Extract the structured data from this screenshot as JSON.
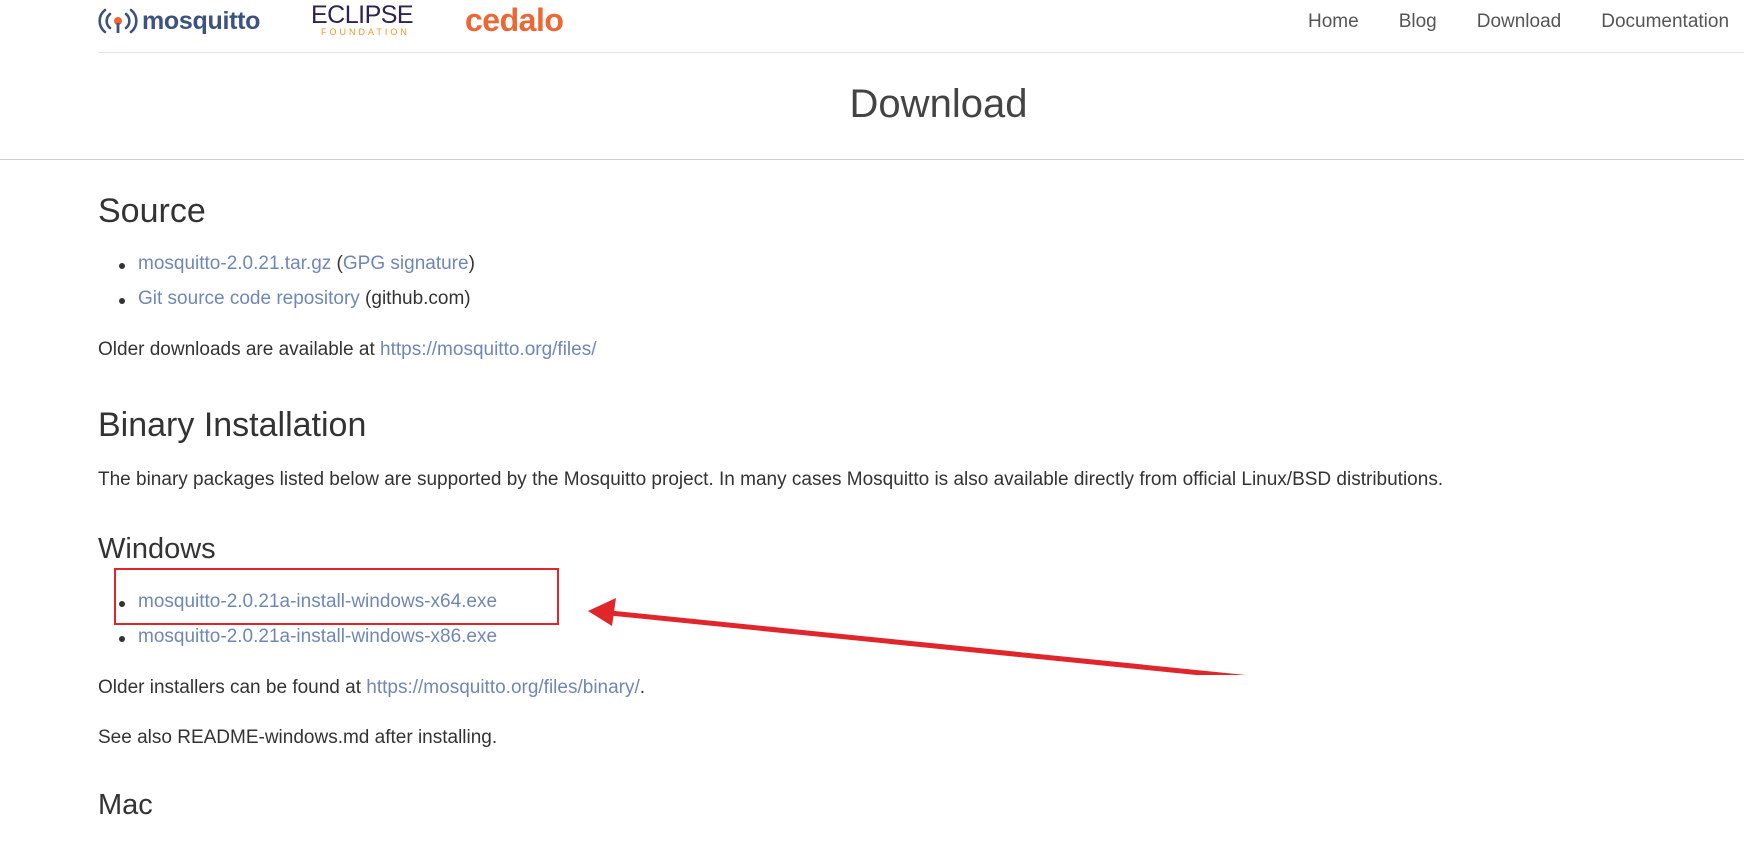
{
  "header": {
    "logos": {
      "mosquitto": "mosquitto",
      "eclipse_name": "ECLIPSE",
      "eclipse_sub": "FOUNDATION",
      "cedalo": "cedalo"
    },
    "nav": [
      "Home",
      "Blog",
      "Download",
      "Documentation"
    ]
  },
  "page": {
    "title": "Download"
  },
  "source": {
    "heading": "Source",
    "items": [
      {
        "link": "mosquitto-2.0.21.tar.gz",
        "open": " (",
        "link2": "GPG signature",
        "close": ")"
      },
      {
        "link": "Git source code repository",
        "suffix": " (github.com)"
      }
    ],
    "older_text": "Older downloads are available at ",
    "older_link": "https://mosquitto.org/files/"
  },
  "binary": {
    "heading": "Binary Installation",
    "text": "The binary packages listed below are supported by the Mosquitto project. In many cases Mosquitto is also available directly from official Linux/BSD distributions."
  },
  "windows": {
    "heading": "Windows",
    "items": [
      "mosquitto-2.0.21a-install-windows-x64.exe",
      "mosquitto-2.0.21a-install-windows-x86.exe"
    ],
    "older_text": "Older installers can be found at ",
    "older_link": "https://mosquitto.org/files/binary/",
    "older_end": ".",
    "readme": "See also README-windows.md after installing."
  },
  "mac": {
    "heading": "Mac"
  },
  "annotation": {
    "color": "#e0262b"
  },
  "colors": {
    "link": "#6f87b7",
    "accent_orange": "#ee6633",
    "brand_blue": "#3c5280"
  }
}
